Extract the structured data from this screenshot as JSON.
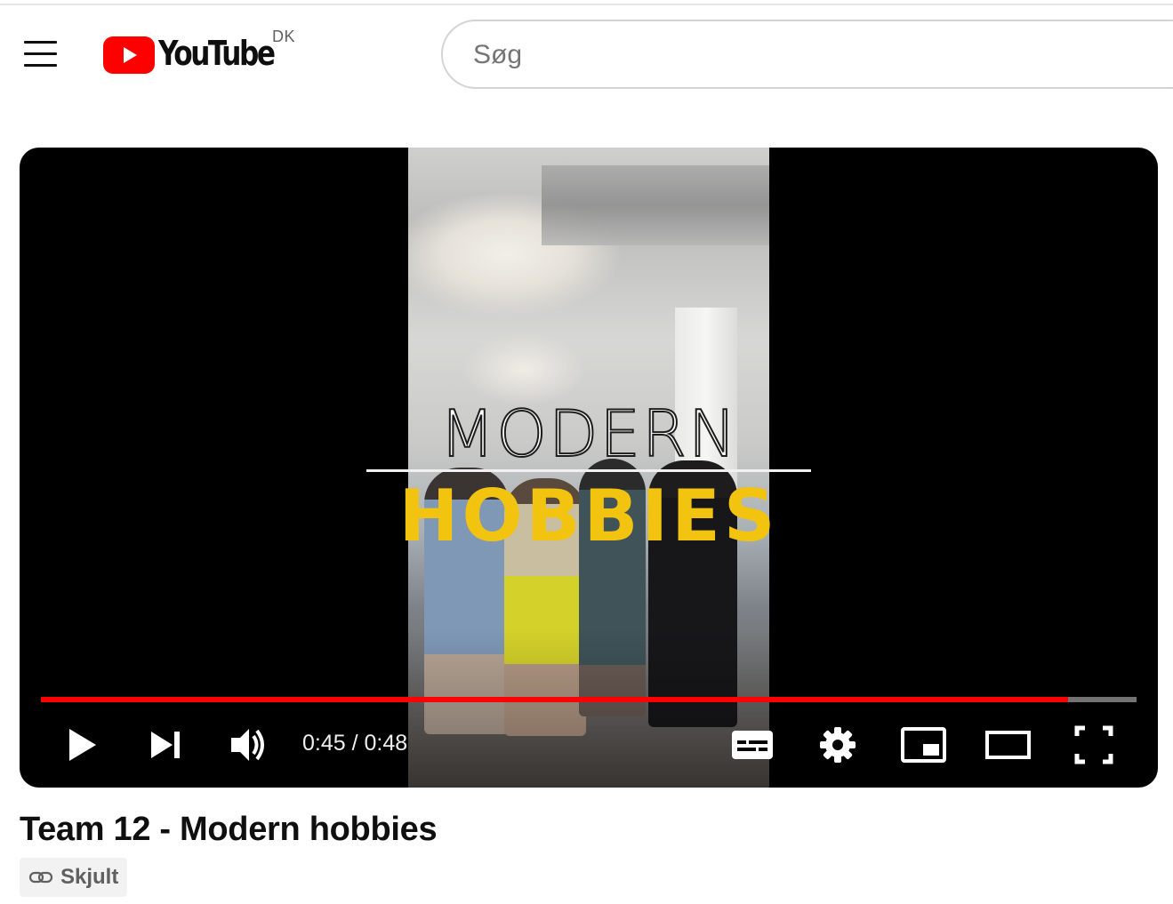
{
  "masthead": {
    "logo_text": "YouTube",
    "country_code": "DK",
    "search_placeholder": "Søg"
  },
  "player": {
    "overlay_line1": "MODERN",
    "overlay_line2": "HOBBIES",
    "current_time": "0:45",
    "duration": "0:48",
    "time_display": "0:45 / 0:48",
    "progress_fraction": 0.9375,
    "controls": [
      "play-icon",
      "next-icon",
      "volume-icon",
      "subtitles-icon",
      "settings-icon",
      "miniplayer-icon",
      "theater-mode-icon",
      "fullscreen-icon"
    ]
  },
  "video": {
    "title": "Team 12 - Modern hobbies",
    "visibility_label": "Skjult",
    "visibility_icon": "link-icon"
  },
  "colors": {
    "brand_red": "#ff0000",
    "overlay_yellow": "#f2c40f"
  }
}
